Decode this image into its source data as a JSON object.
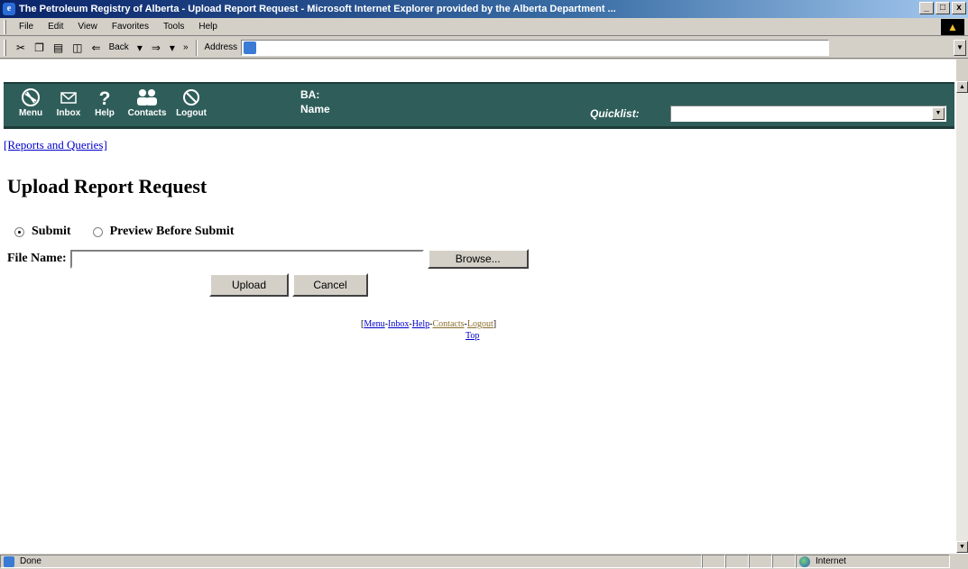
{
  "window": {
    "title": "The Petroleum Registry of Alberta - Upload Report Request - Microsoft Internet Explorer provided by the Alberta Department ...",
    "buttons": [
      "_",
      "□",
      "x"
    ]
  },
  "menubar": {
    "items": [
      "File",
      "Edit",
      "View",
      "Favorites",
      "Tools",
      "Help"
    ]
  },
  "toolbar": {
    "back_label": "Back",
    "more_label": "»",
    "address_label": "Address",
    "address_value": ""
  },
  "appbar": {
    "nav": [
      {
        "label": "Menu",
        "icon": "menu-icon"
      },
      {
        "label": "Inbox",
        "icon": "envelope-icon"
      },
      {
        "label": "Help",
        "icon": "question-icon"
      },
      {
        "label": "Contacts",
        "icon": "people-icon"
      },
      {
        "label": "Logout",
        "icon": "logout-icon"
      }
    ],
    "ba_line1": "BA:",
    "ba_line2": "Name",
    "quicklist_label": "Quicklist:",
    "quicklist_value": ""
  },
  "page": {
    "reports_link": "[Reports and Queries]",
    "title": "Upload Report Request",
    "radio_submit": "Submit",
    "radio_preview": "Preview Before Submit",
    "selected_option": "Submit",
    "file_label": "File Name:",
    "file_value": "",
    "browse_label": "Browse...",
    "upload_label": "Upload",
    "cancel_label": "Cancel"
  },
  "footer": {
    "open_bracket": "[",
    "menu": "Menu",
    "inbox": "Inbox",
    "help": "Help",
    "contacts": "Contacts",
    "logout": "Logout",
    "sep": "-",
    "close_bracket": "]",
    "top": "Top"
  },
  "statusbar": {
    "status": "Done",
    "zone": "Internet"
  }
}
